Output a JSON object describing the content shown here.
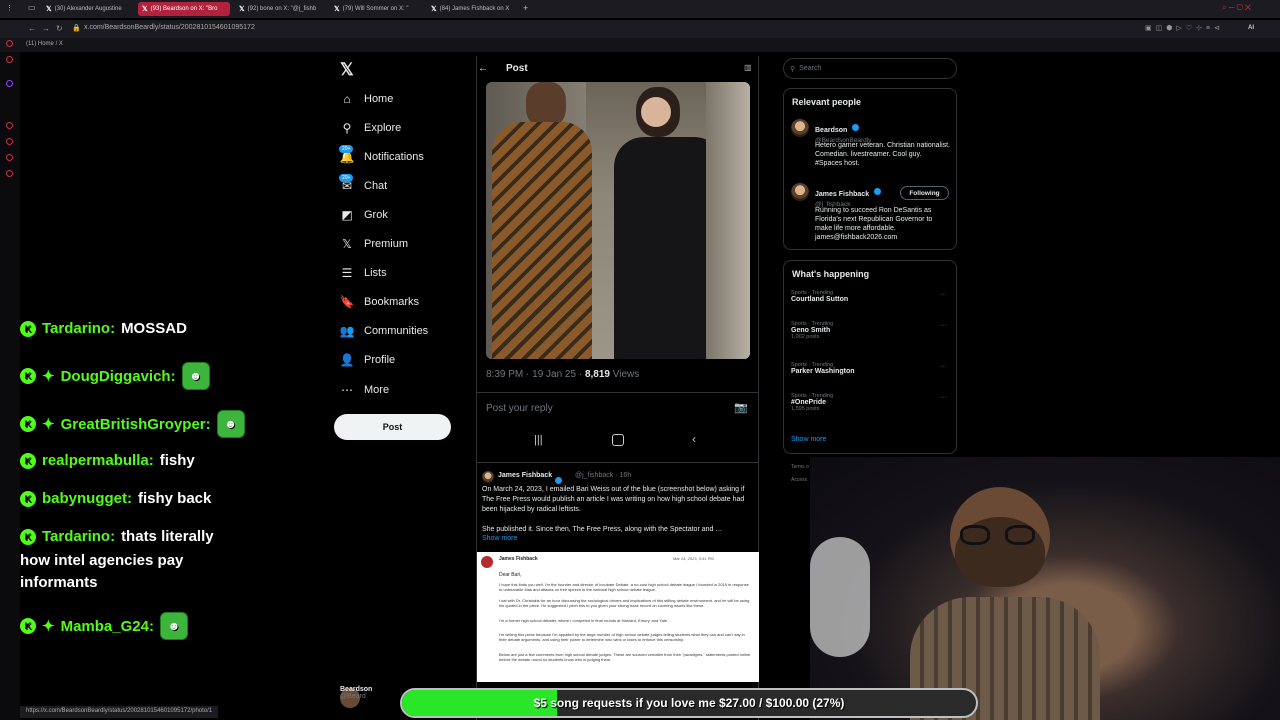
{
  "browser": {
    "tabs": [
      {
        "label": "(30) Alexander Augustine",
        "active": false
      },
      {
        "label": "(93) Beardson on X: \"Bro",
        "active": true
      },
      {
        "label": "(92) bone on X: \"@j_fishb",
        "active": false
      },
      {
        "label": "(79) Will Sommer on X: \"",
        "active": false
      },
      {
        "label": "(84) James Fishback on X",
        "active": false
      }
    ],
    "url": "x.com/BeardsonBeardly/status/2002810154601095172",
    "subbar_title": "(11) Home / X",
    "status_url": "https://x.com/BeardsonBeardly/status/2002810154601095172/photo/1"
  },
  "nav": {
    "items": [
      {
        "label": "Home",
        "icon": "home-icon",
        "glyph": "⌂"
      },
      {
        "label": "Explore",
        "icon": "search-icon",
        "glyph": "⚲"
      },
      {
        "label": "Notifications",
        "icon": "bell-icon",
        "glyph": "🔔",
        "badge": "20+"
      },
      {
        "label": "Chat",
        "icon": "mail-icon",
        "glyph": "✉",
        "badge": "20+"
      },
      {
        "label": "Grok",
        "icon": "grok-icon",
        "glyph": "◩"
      },
      {
        "label": "Premium",
        "icon": "x-logo-icon",
        "glyph": "𝕏"
      },
      {
        "label": "Lists",
        "icon": "list-icon",
        "glyph": "☰"
      },
      {
        "label": "Bookmarks",
        "icon": "bookmark-icon",
        "glyph": "🔖"
      },
      {
        "label": "Communities",
        "icon": "people-icon",
        "glyph": "👥"
      },
      {
        "label": "Profile",
        "icon": "person-icon",
        "glyph": "👤"
      },
      {
        "label": "More",
        "icon": "more-icon",
        "glyph": "⋯"
      }
    ],
    "post_button": "Post"
  },
  "post": {
    "header_title": "Post",
    "time": "8:39 PM · 19 Jan 25 · ",
    "views_count": "8,819",
    "views_label": " Views",
    "reply_placeholder": "Post your reply"
  },
  "quoted": {
    "name": "James Fishback",
    "handle": "@j_fishback · 16h",
    "text": "On March 24, 2023, I emailed Bari Weiss out of the blue (screenshot below) asking if The Free Press would publish an article I was writing on how high school debate had been hijacked by radical leftists.",
    "text2": "She published it. Since then, The Free Press, along with the Spectator and …",
    "show_more": "Show more",
    "doc": {
      "sender": "James Fishback",
      "date": "Mar 24, 2023, 3:41 PM",
      "greeting": "Dear Bari,",
      "para1": "I hope this finds you well. I'm the founder and director of Incubate Debate, a no-cost high school debate league I founded in 2019 in response to unbearable bias and attacks on free speech in the national high school debate league.",
      "para2": "I sat with Dr. Christakis for an hour discussing the sociological drivers and implications of this stifling debate environment, and he will be using his quoted in the piece. He suggested I pitch this to you given your strong track record on covering issues like these.",
      "para3": "I'm a former high school debater, where I competed in final rounds at Harvard, Emory, and Yale.",
      "para4": "I'm writing this piece because I'm appalled by the large number of high school debate judges telling students what they can and can't say in their debate arguments, and using their power to determine who wins or loses to enforce this censorship.",
      "para5": "Below are just a few comments from high school debate judges. These are sourced verbatim from their \"paradigms,\" statements posted online before the debate round so students know who is judging them."
    }
  },
  "right": {
    "search_placeholder": "Search",
    "relevant_title": "Relevant people",
    "people": [
      {
        "name": "Beardson",
        "handle": "@BeardsonBeardly",
        "bio": "Hetero gamer veteran. Christian nationalist. Comedian. livestreamer. Cool guy. #Spaces host."
      },
      {
        "name": "James Fishback",
        "handle": "@j_fishback",
        "bio": "Running to succeed Ron DeSantis as Florida's next Republican Governor to make life more affordable. james@fishback2026.com",
        "button": "Following"
      }
    ],
    "happening_title": "What's happening",
    "trends": [
      {
        "category": "Sports · Trending",
        "name": "Courtland Sutton",
        "count": ""
      },
      {
        "category": "Sports · Trending",
        "name": "Geno Smith",
        "count": "1,002 posts"
      },
      {
        "category": "Sports · Trending",
        "name": "Parker Washington",
        "count": ""
      },
      {
        "category": "Sports · Trending",
        "name": "#OnePride",
        "count": "1,595 posts"
      }
    ],
    "show_more": "Show more",
    "footer": "Terms o",
    "footer2": "Access"
  },
  "chat": [
    {
      "user": "Tardarino:",
      "message": "MOSSAD",
      "star": false
    },
    {
      "user": "DougDiggavich:",
      "message": "",
      "star": true,
      "emote": true
    },
    {
      "user": "GreatBritishGroyper:",
      "message": "",
      "star": true,
      "emote": true
    },
    {
      "user": "realpermabulla:",
      "message": "fishy",
      "star": false
    },
    {
      "user": "babynugget:",
      "message": "fishy back",
      "star": false
    },
    {
      "user": "Tardarino:",
      "message": "thats literally",
      "star": false
    },
    {
      "user": "Mamba_G24:",
      "message": "",
      "star": true,
      "emote": true
    }
  ],
  "chat_wrap_lines": [
    "how intel agencies pay",
    "informants"
  ],
  "goal": {
    "text": "$5 song requests if you love me $27.00 / $100.00 (27%)",
    "progress": 0.27
  },
  "bottom_user": "Beardson",
  "bottom_handle": "@Beard"
}
